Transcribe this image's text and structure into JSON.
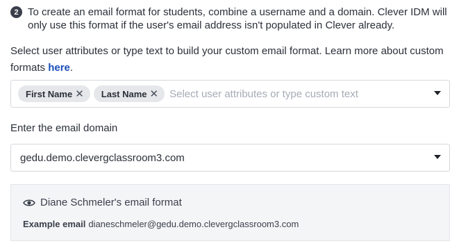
{
  "step": {
    "number": "2",
    "text": "To create an email format for students, combine a username and a domain. Clever IDM will only use this format if the user's email address isn't populated in Clever already."
  },
  "intro": {
    "text": "Select user attributes or type text to build your custom email format. Learn more about custom formats ",
    "link": "here",
    "suffix": "."
  },
  "format_select": {
    "chips": [
      {
        "label": "First Name",
        "remove": "✕"
      },
      {
        "label": "Last Name",
        "remove": "✕"
      }
    ],
    "placeholder": "Select user attributes or type custom text"
  },
  "domain": {
    "label": "Enter the email domain",
    "value": "gedu.demo.clevergclassroom3.com"
  },
  "preview": {
    "title": "Diane Schmeler's email format",
    "example_label": "Example email",
    "example_value": "dianeschmeler@gedu.demo.clevergclassroom3.com"
  }
}
